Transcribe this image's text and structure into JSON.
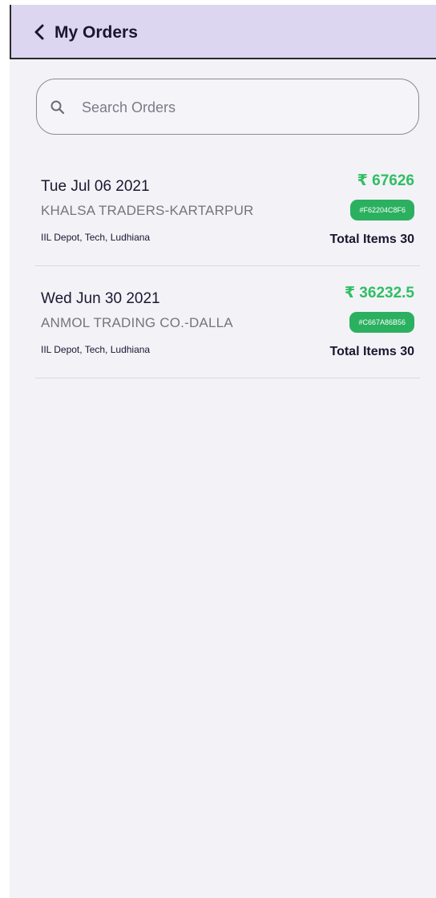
{
  "header": {
    "title": "My Orders",
    "back_icon": "chevron-left-icon"
  },
  "search": {
    "placeholder": "Search Orders",
    "value": "",
    "icon": "search-icon"
  },
  "colors": {
    "app_bar": "#dcd6f0",
    "amount": "#2fbf63",
    "badge": "#2bb060",
    "background": "#f3f2f7"
  },
  "orders": [
    {
      "date": "Tue Jul 06 2021",
      "amount": "₹ 67626",
      "party": "KHALSA TRADERS-KARTARPUR",
      "order_id": "#F62204C8F6",
      "depot": "IIL Depot, Tech, Ludhiana",
      "total_items": "Total Items 30"
    },
    {
      "date": "Wed Jun 30 2021",
      "amount": "₹ 36232.5",
      "party": "ANMOL TRADING CO.-DALLA",
      "order_id": "#C667A86B56",
      "depot": "IIL Depot, Tech, Ludhiana",
      "total_items": "Total Items 30"
    }
  ]
}
